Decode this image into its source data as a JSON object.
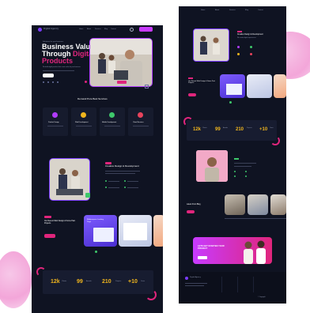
{
  "left_page": {
    "header": {
      "logo": "Digital Agency",
      "nav": [
        "Home",
        "About",
        "Services",
        "Blog",
        "Contact"
      ],
      "cta": "Get Started"
    },
    "hero": {
      "eyebrow": "Solutions for your business",
      "title_line1": "Business Value",
      "title_line2": "Through",
      "title_accent1": "Digital",
      "title_line3": "Products",
      "body": "We build digital products that create value for your business.",
      "cta": "Learn More"
    },
    "services": {
      "title": "Demand Pure Best Services",
      "items": [
        {
          "title": "Product Design",
          "icon_color": "#b13cff"
        },
        {
          "title": "Web Development",
          "icon_color": "#f0b51d"
        },
        {
          "title": "Mobile Development",
          "icon_color": "#3ec86b"
        },
        {
          "title": "Cloud Services",
          "icon_color": "#e8435c"
        }
      ]
    },
    "about": {
      "badge": "About",
      "title": "Creative Design & Development",
      "body": "Our team delivers modern design and development for every client."
    },
    "portfolio": {
      "badge": "Work",
      "title": "Our Recent Web Design & Some Past Projects",
      "cta": "View All",
      "card_title": "Multipurpose Landing Page"
    },
    "stats": [
      {
        "value": "12k",
        "label": "Clients"
      },
      {
        "value": "99",
        "label": "Awards"
      },
      {
        "value": "210",
        "label": "Projects"
      },
      {
        "value": "+10",
        "label": "Years"
      }
    ]
  },
  "right_page": {
    "header": {
      "nav": [
        "Home",
        "About",
        "Services",
        "Blog",
        "Contact"
      ]
    },
    "about": {
      "title": "Creative Design & Development",
      "body": "We create digital experiences."
    },
    "work": {
      "title": "Our Recent Web Design & Some Past Projects",
      "cta": "View All"
    },
    "stats": [
      {
        "value": "12k",
        "label": "Clients"
      },
      {
        "value": "99",
        "label": "Awards"
      },
      {
        "value": "210",
        "label": "Projects"
      },
      {
        "value": "+10",
        "label": "Years"
      }
    ],
    "blog": {
      "title": "Latest From Blog"
    },
    "cta_banner": {
      "title": "LETS GET STARTED YOUR PROJECT",
      "button": "Contact"
    },
    "footer": {
      "logo": "Digital Agency",
      "copyright": "© Copyright"
    }
  },
  "colors": {
    "page_bg": "#0f1322",
    "accent": "#e0257c",
    "highlight_pink": "#e0257c",
    "stat_yellow": "#f0b51d",
    "canvas": "#ffffff"
  }
}
